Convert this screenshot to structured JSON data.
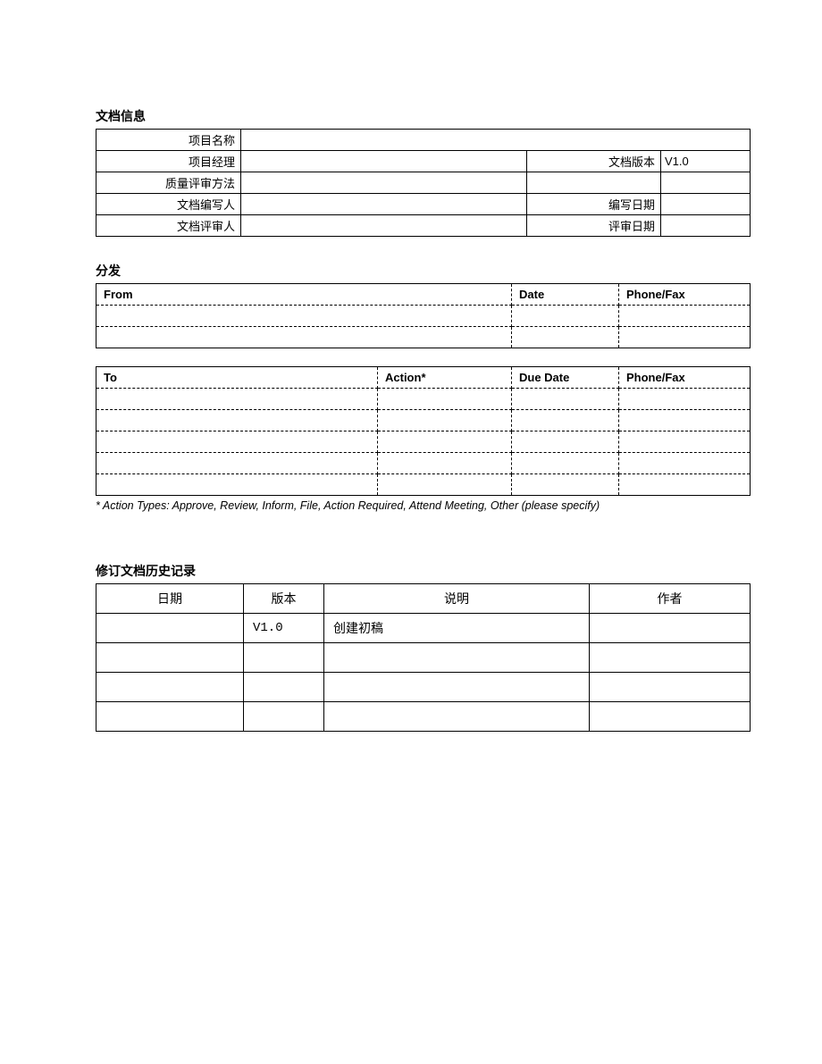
{
  "docinfo": {
    "title": "文档信息",
    "labels": {
      "project_name": "项目名称",
      "project_manager": "项目经理",
      "doc_version": "文档版本",
      "quality_method": "质量评审方法",
      "author": "文档编写人",
      "write_date": "编写日期",
      "reviewer": "文档评审人",
      "review_date": "评审日期"
    },
    "values": {
      "project_name": "",
      "project_manager": "",
      "doc_version": "V1.0",
      "quality_method": "",
      "author": "",
      "write_date": "",
      "reviewer": "",
      "review_date": ""
    }
  },
  "distribution": {
    "title": "分发",
    "from_table": {
      "headers": {
        "from": "From",
        "date": "Date",
        "phone": "Phone/Fax"
      },
      "rows": [
        {
          "from": "",
          "date": "",
          "phone": ""
        },
        {
          "from": "",
          "date": "",
          "phone": ""
        }
      ]
    },
    "to_table": {
      "headers": {
        "to": "To",
        "action": "Action*",
        "due_date": "Due Date",
        "phone": "Phone/Fax"
      },
      "rows": [
        {
          "to": "",
          "action": "",
          "due_date": "",
          "phone": ""
        },
        {
          "to": "",
          "action": "",
          "due_date": "",
          "phone": ""
        },
        {
          "to": "",
          "action": "",
          "due_date": "",
          "phone": ""
        },
        {
          "to": "",
          "action": "",
          "due_date": "",
          "phone": ""
        },
        {
          "to": "",
          "action": "",
          "due_date": "",
          "phone": ""
        }
      ]
    },
    "note": "* Action Types: Approve, Review, Inform, File, Action Required, Attend Meeting, Other (please specify)"
  },
  "revision": {
    "title": "修订文档历史记录",
    "headers": {
      "date": "日期",
      "version": "版本",
      "desc": "说明",
      "author": "作者"
    },
    "rows": [
      {
        "date": "",
        "version": "V1.0",
        "desc": "创建初稿",
        "author": ""
      },
      {
        "date": "",
        "version": "",
        "desc": "",
        "author": ""
      },
      {
        "date": "",
        "version": "",
        "desc": "",
        "author": ""
      },
      {
        "date": "",
        "version": "",
        "desc": "",
        "author": ""
      }
    ]
  }
}
